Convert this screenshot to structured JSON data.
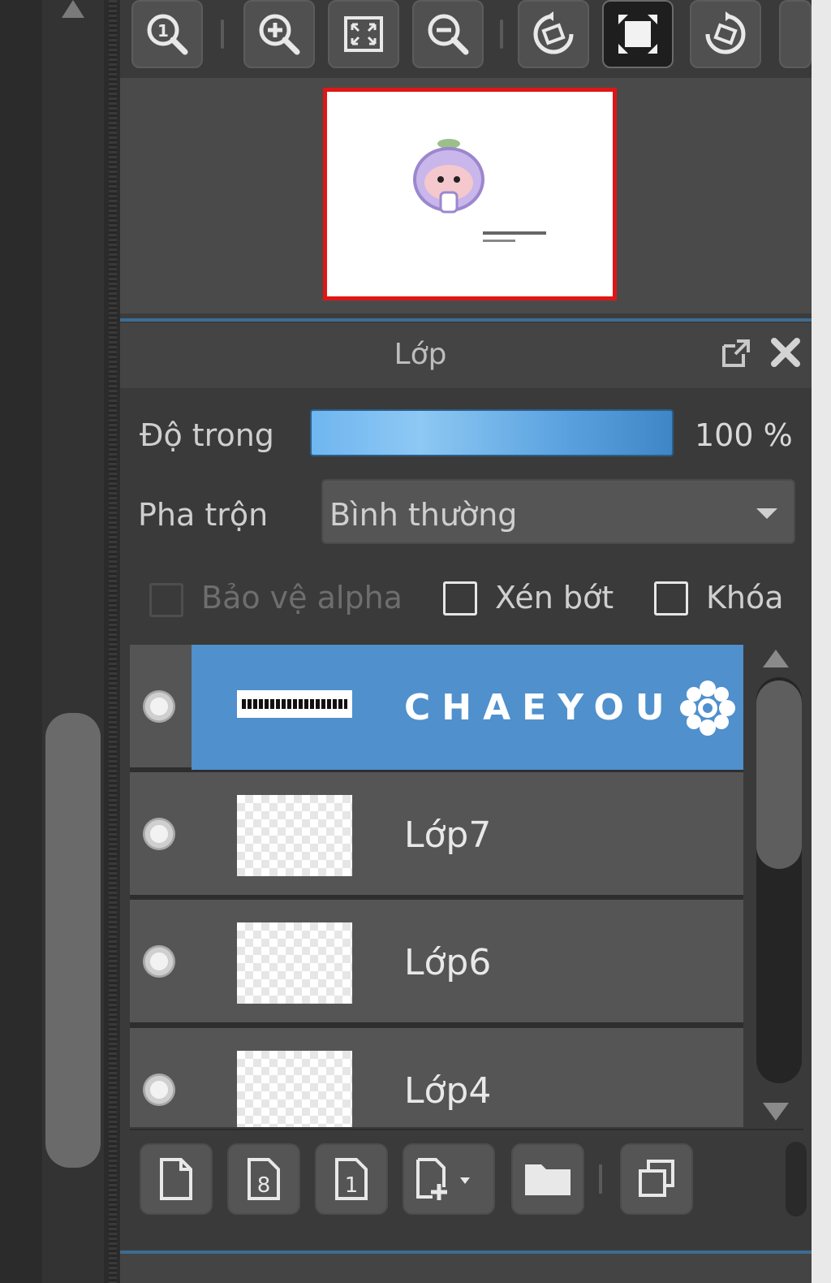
{
  "toolbar": {
    "buttons": [
      {
        "id": "zoom-actual",
        "icon": "zoom-actual-size-icon"
      },
      {
        "id": "zoom-in",
        "icon": "zoom-in-icon"
      },
      {
        "id": "fit-screen",
        "icon": "fit-screen-icon"
      },
      {
        "id": "zoom-out",
        "icon": "zoom-out-icon"
      },
      {
        "id": "rotate-left",
        "icon": "rotate-left-icon"
      },
      {
        "id": "flip",
        "icon": "flip-horizontal-icon"
      },
      {
        "id": "rotate-right",
        "icon": "rotate-right-icon"
      }
    ]
  },
  "layer_panel": {
    "title": "Lớp",
    "opacity_label": "Độ trong",
    "opacity_value": "100 %",
    "opacity_fraction": 1.0,
    "blend_label": "Pha trộn",
    "blend_value": "Bình thường",
    "checkboxes": {
      "protect_alpha": {
        "label": "Bảo vệ alpha",
        "checked": false,
        "enabled": false
      },
      "clipping": {
        "label": "Xén bớt",
        "checked": false,
        "enabled": true
      },
      "lock": {
        "label": "Khóa",
        "checked": false,
        "enabled": true
      }
    },
    "layers": [
      {
        "name": "CHAEYOU",
        "selected": true,
        "visible": true,
        "thumb": "text"
      },
      {
        "name": "Lớp7",
        "selected": false,
        "visible": true,
        "thumb": "transparent"
      },
      {
        "name": "Lớp6",
        "selected": false,
        "visible": true,
        "thumb": "transparent"
      },
      {
        "name": "Lớp4",
        "selected": false,
        "visible": true,
        "thumb": "transparent"
      }
    ],
    "tools": [
      {
        "id": "new-layer",
        "icon": "new-layer-icon"
      },
      {
        "id": "new-8bit-layer",
        "icon": "new-8bit-layer-icon",
        "glyph": "8"
      },
      {
        "id": "new-1bit-layer",
        "icon": "new-1bit-layer-icon",
        "glyph": "1"
      },
      {
        "id": "add-layer-menu",
        "icon": "add-layer-menu-icon"
      },
      {
        "id": "new-folder",
        "icon": "folder-icon"
      },
      {
        "id": "duplicate-layer",
        "icon": "duplicate-layer-icon"
      }
    ]
  },
  "colors": {
    "accent": "#4f90cd",
    "navigator_border": "#e01616",
    "panel_separator": "#3d6c92"
  }
}
